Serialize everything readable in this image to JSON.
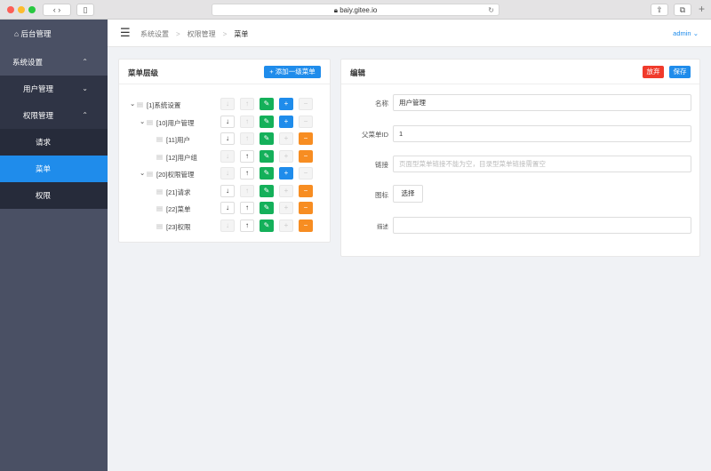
{
  "browser": {
    "url": "baiy.gitee.io"
  },
  "sidebar": {
    "brand": "后台管理",
    "items": [
      {
        "label": "系统设置",
        "chevron": "up"
      },
      {
        "label": "用户管理",
        "chevron": "down"
      },
      {
        "label": "权限管理",
        "chevron": "up"
      },
      {
        "label": "请求"
      },
      {
        "label": "菜单",
        "active": true
      },
      {
        "label": "权限"
      }
    ]
  },
  "header": {
    "breadcrumb": [
      "系统设置",
      "权限管理",
      "菜单"
    ],
    "user": "admin"
  },
  "tree": {
    "title": "菜单层级",
    "add_root_label": "+ 添加一级菜单",
    "nodes": [
      {
        "label": "[1]系统设置",
        "level": 0,
        "expandable": true,
        "down": false,
        "up": false,
        "add": true,
        "remove": false
      },
      {
        "label": "[10]用户管理",
        "level": 1,
        "expandable": true,
        "down": true,
        "up": false,
        "add": true,
        "remove": false
      },
      {
        "label": "[11]用户",
        "level": 2,
        "expandable": false,
        "down": true,
        "up": false,
        "add": false,
        "remove": true
      },
      {
        "label": "[12]用户组",
        "level": 2,
        "expandable": false,
        "down": false,
        "up": true,
        "add": false,
        "remove": true
      },
      {
        "label": "[20]权限管理",
        "level": 1,
        "expandable": true,
        "down": false,
        "up": true,
        "add": true,
        "remove": false
      },
      {
        "label": "[21]请求",
        "level": 2,
        "expandable": false,
        "down": true,
        "up": false,
        "add": false,
        "remove": true
      },
      {
        "label": "[22]菜单",
        "level": 2,
        "expandable": false,
        "down": true,
        "up": true,
        "add": false,
        "remove": true
      },
      {
        "label": "[23]权限",
        "level": 2,
        "expandable": false,
        "down": false,
        "up": true,
        "add": false,
        "remove": true
      }
    ]
  },
  "edit": {
    "title": "编辑",
    "discard_label": "放弃",
    "save_label": "保存",
    "fields": {
      "name_label": "名称",
      "name_value": "用户管理",
      "parent_label": "父菜单ID",
      "parent_value": "1",
      "link_label": "链接",
      "link_placeholder": "页面型菜单链接不能为空，目录型菜单链接需置空",
      "icon_label": "图标",
      "icon_button": "选择",
      "desc_label": "描述",
      "desc_value": ""
    }
  },
  "colors": {
    "primary": "#1f8ceb",
    "success": "#14b05a",
    "warning": "#f78d22",
    "danger": "#f03a2b",
    "sidebar": "#4a5064"
  }
}
